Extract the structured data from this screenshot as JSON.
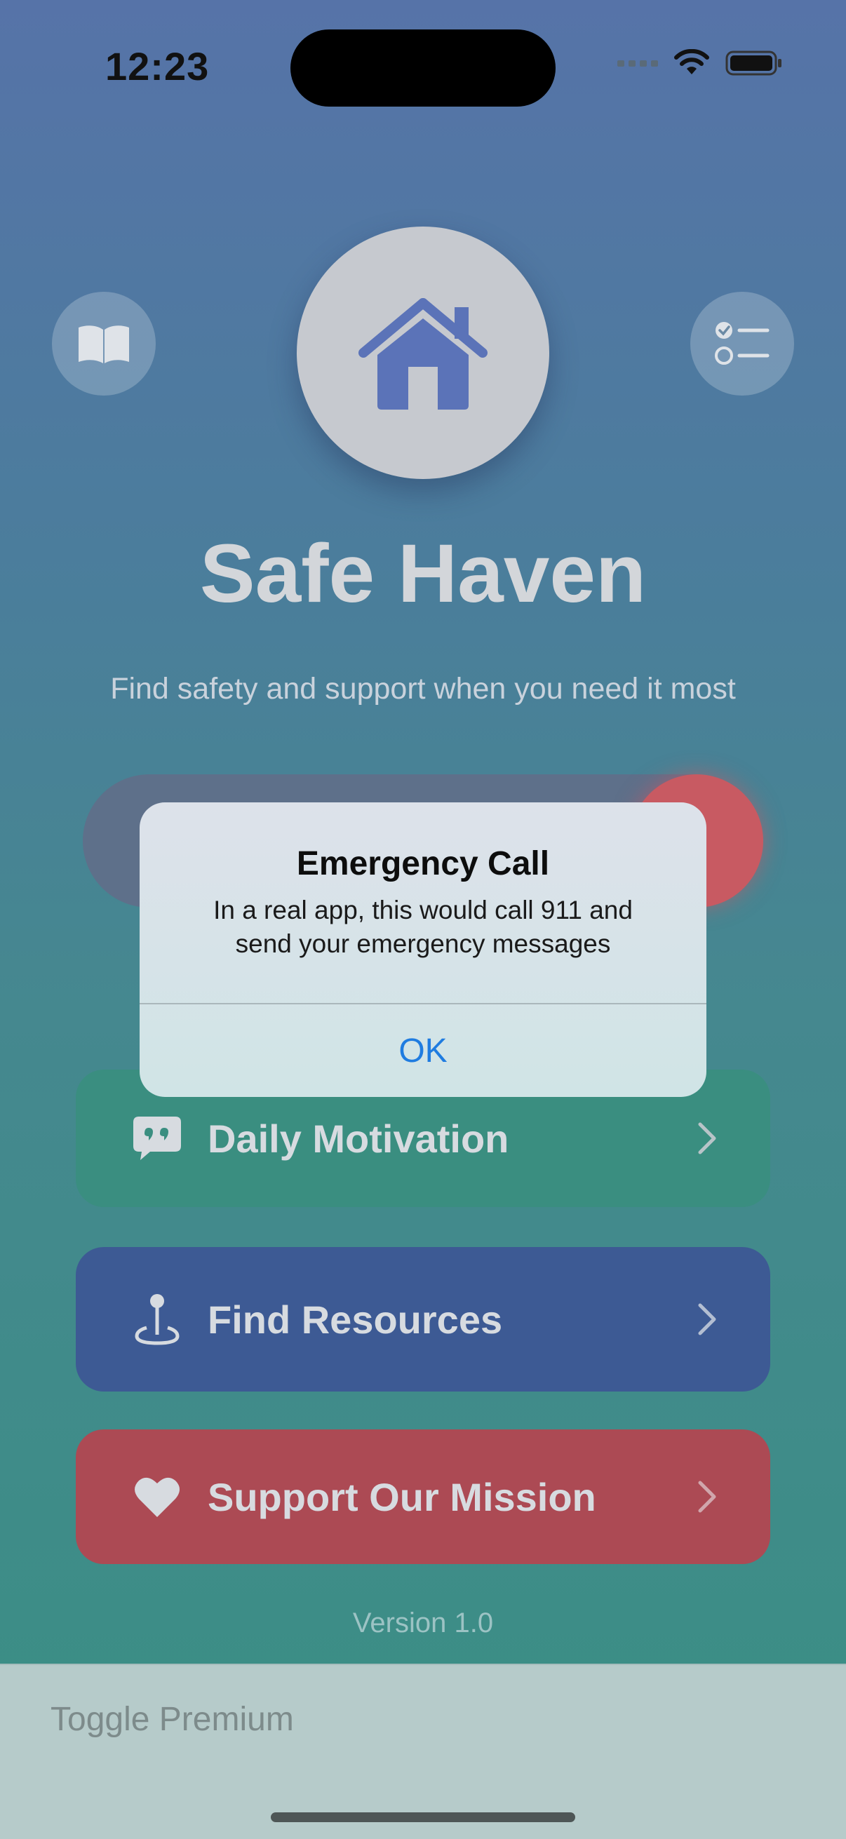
{
  "status_bar": {
    "time": "12:23"
  },
  "header": {
    "app_title": "Safe Haven",
    "tagline": "Find safety and support when you need it most",
    "left_button_icon": "book-icon",
    "right_button_icon": "checklist-icon",
    "logo_icon": "house-icon"
  },
  "menu": {
    "items": [
      {
        "label": "Daily Motivation",
        "icon": "quote-bubble-icon"
      },
      {
        "label": "Find Resources",
        "icon": "location-pin-icon"
      },
      {
        "label": "Support Our Mission",
        "icon": "heart-icon"
      }
    ]
  },
  "footer": {
    "version": "Version 1.0"
  },
  "bottom_bar": {
    "premium_label": "Toggle Premium"
  },
  "alert": {
    "title": "Emergency Call",
    "message": "In a real app, this would call 911 and send your emergency messages",
    "ok_label": "OK"
  },
  "colors": {
    "accent_blue": "#1f7ce0",
    "motivation_card": "#3a8e80",
    "resources_card": "#3d5a94",
    "support_card": "#ac4a54",
    "sos_red": "#c85a62"
  }
}
